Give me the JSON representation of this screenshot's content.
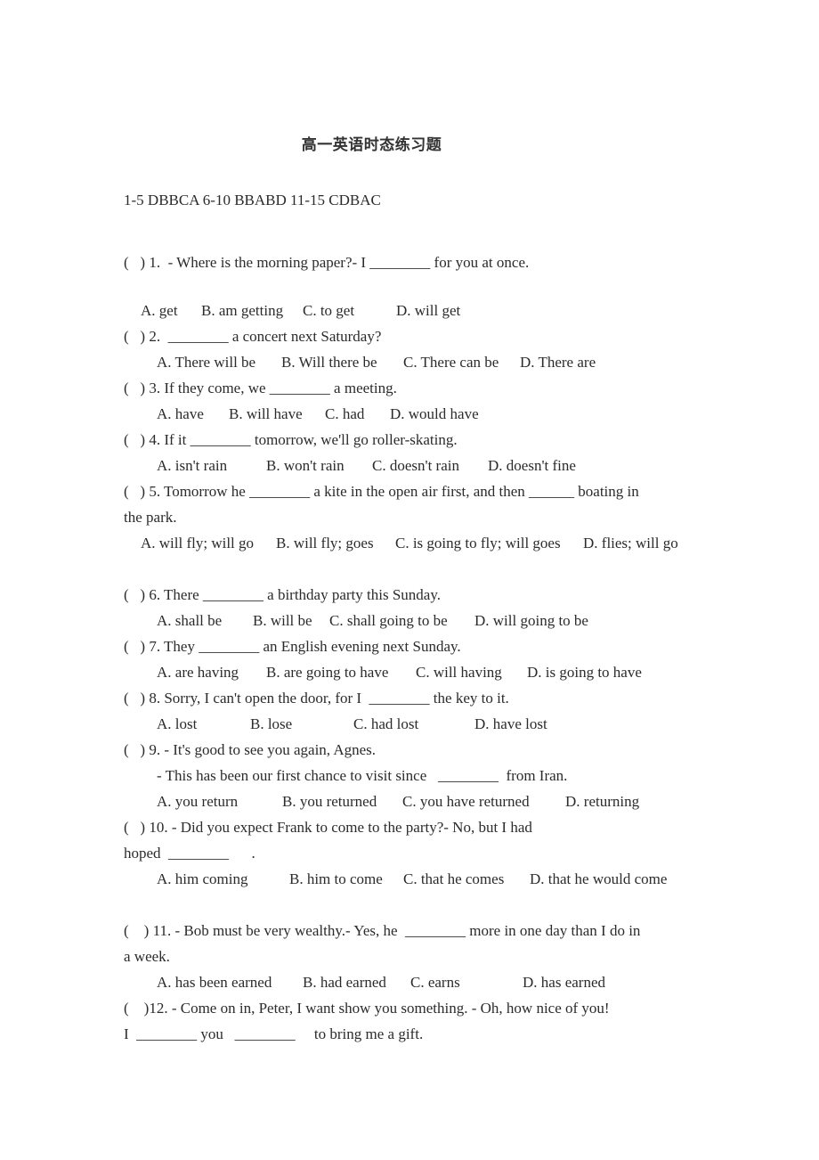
{
  "title": "高一英语时态练习题",
  "answer_key": "1-5 DBBCA 6-10 BBABD 11-15 CDBAC",
  "questions": [
    {
      "num": "1",
      "stem": "(   ) 1.  - Where is the morning paper?- I ________ for you at once.",
      "options": [
        "A. get",
        "B. am getting",
        "C. to get",
        "D. will get"
      ]
    },
    {
      "num": "2",
      "stem": "(   ) 2.  ________ a concert next Saturday?",
      "options": [
        "A. There will be",
        "B. Will there be",
        "C. There can be",
        "D. There are"
      ]
    },
    {
      "num": "3",
      "stem": "(   ) 3. If they come, we ________ a meeting.",
      "options": [
        "A. have",
        "B. will have",
        "C. had",
        "D. would have"
      ]
    },
    {
      "num": "4",
      "stem": "(   ) 4. If it ________ tomorrow, we'll go roller-skating.",
      "options": [
        "A. isn't rain",
        "B. won't rain",
        "C. doesn't rain",
        "D. doesn't fine"
      ]
    },
    {
      "num": "5",
      "stem": "(   ) 5. Tomorrow he ________ a kite in the open air first, and then ______ boating in",
      "stem_cont": "the park.",
      "options": [
        "A. will fly; will go",
        "B. will fly; goes",
        "C. is going to fly; will goes",
        "D. flies; will go"
      ]
    },
    {
      "num": "6",
      "stem": "(   ) 6. There ________ a birthday party this Sunday.",
      "options": [
        "A. shall be",
        "B. will be",
        "C. shall going to be",
        "D. will going to be"
      ]
    },
    {
      "num": "7",
      "stem": "(   ) 7. They ________ an English evening next Sunday.",
      "options": [
        "A. are having",
        "B. are going to have",
        "C. will having",
        "D. is going to have"
      ]
    },
    {
      "num": "8",
      "stem": "(   ) 8. Sorry, I can't open the door, for I  ________ the key to it.",
      "options": [
        "A. lost",
        "B. lose",
        "C. had lost",
        "D. have lost"
      ]
    },
    {
      "num": "9",
      "stem": "(   ) 9. - It's good to see you again, Agnes.",
      "stem_cont": "- This has been our first chance to visit since   ________  from Iran.",
      "options": [
        "A. you return",
        "B. you returned",
        "C. you have returned",
        "D. returning"
      ]
    },
    {
      "num": "10",
      "stem": "(   ) 10. - Did you expect Frank to come to the party?- No, but I had",
      "stem_cont": "hoped  ________      .",
      "options": [
        "A. him coming",
        "B. him to come",
        "C. that he comes",
        "D. that he would come"
      ]
    },
    {
      "num": "11",
      "stem": "(    ) 11. - Bob must be very wealthy.- Yes, he  ________ more in one day than I do in",
      "stem_cont": "a week.",
      "options": [
        "A. has been earned",
        "B. had earned",
        "C. earns",
        "D. has earned"
      ]
    },
    {
      "num": "12",
      "stem": "(    )12. - Come on in, Peter, I want show you something. - Oh, how nice of you!",
      "stem_cont": "I  ________ you   ________     to bring me a gift."
    }
  ]
}
